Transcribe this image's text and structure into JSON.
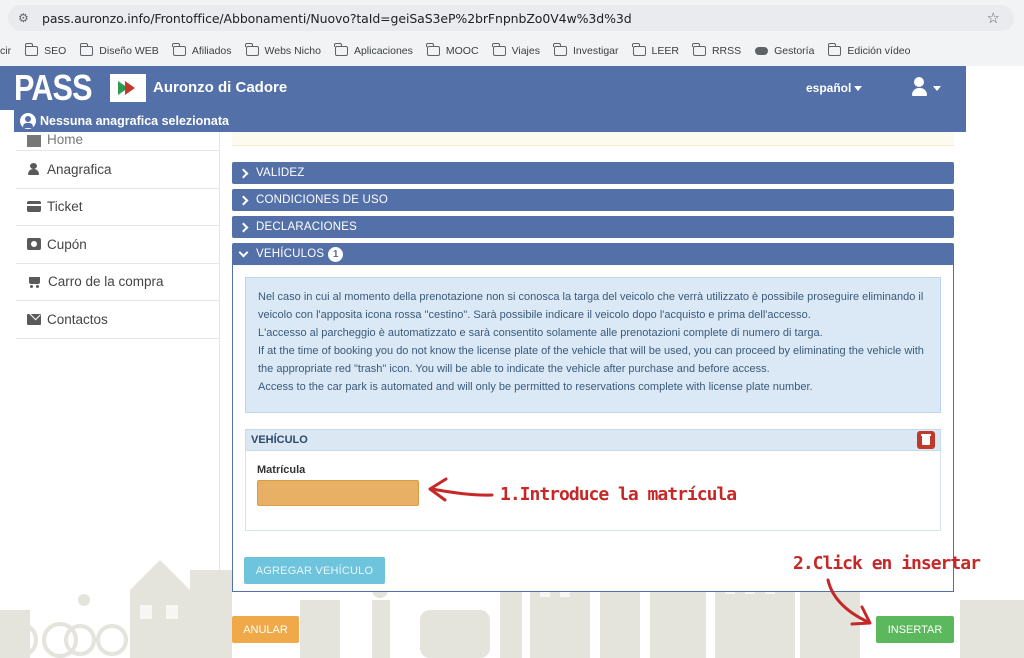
{
  "browser": {
    "url": "pass.auronzo.info/Frontoffice/Abbonamenti/Nuovo?taId=geiSaS3eP%2brFnpnbZo0V4w%3d%3d",
    "bookmarks": [
      "cir",
      "SEO",
      "Diseño WEB",
      "Afiliados",
      "Webs Nicho",
      "Aplicaciones",
      "MOOC",
      "Viajes",
      "Investigar",
      "LEER",
      "RRSS",
      "Gestoría",
      "Edición vídeo"
    ]
  },
  "header": {
    "logo_text": "PASS",
    "site_name": "Auronzo di Cadore",
    "language": "español",
    "anagrafica_banner": "Nessuna anagrafica selezionata"
  },
  "sidebar": {
    "items": [
      {
        "label": "Home",
        "icon": "home-icon"
      },
      {
        "label": "Anagrafica",
        "icon": "person-icon"
      },
      {
        "label": "Ticket",
        "icon": "credit-card-icon"
      },
      {
        "label": "Cupón",
        "icon": "money-icon"
      },
      {
        "label": "Carro de la compra",
        "icon": "cart-icon"
      },
      {
        "label": "Contactos",
        "icon": "envelope-icon"
      }
    ]
  },
  "sections": {
    "validez": "VALIDEZ",
    "condiciones": "CONDICIONES DE USO",
    "declaraciones": "DECLARACIONES",
    "vehiculos": "VEHÍCULOS",
    "vehiculos_count": "1"
  },
  "info": {
    "p1": "Nel caso in cui al momento della prenotazione non si conosca la targa del veicolo che verrà utilizzato è possibile proseguire eliminando il veicolo con l'apposita icona rossa \"cestino\". Sarà possibile indicare il veicolo dopo l'acquisto e prima dell'accesso.",
    "p2": "L'accesso al parcheggio è automatizzato e sarà consentito solamente alle prenotazioni complete di numero di targa.",
    "p3": "If at the time of booking you do not know the license plate of the vehicle that will be used, you can proceed by eliminating the vehicle with the appropriate red \"trash\" icon. You will be able to indicate the vehicle after purchase and before access.",
    "p4": "Access to the car park is automated and will only be permitted to reservations complete with license plate number."
  },
  "vehicle": {
    "title": "VEHÍCULO",
    "plate_label": "Matrícula",
    "plate_value": ""
  },
  "buttons": {
    "add_vehicle": "AGREGAR VEHÍCULO",
    "cancel": "ANULAR",
    "insert": "INSERTAR"
  },
  "annotations": {
    "step1": "1.Introduce la matrícula",
    "step2": "2.Click en insertar"
  },
  "colors": {
    "brand_blue": "#5470a8",
    "insert_green": "#5cb85c",
    "cancel_orange": "#f0a948",
    "annotation_red": "#c62828",
    "plate_input": "#e8b064"
  }
}
